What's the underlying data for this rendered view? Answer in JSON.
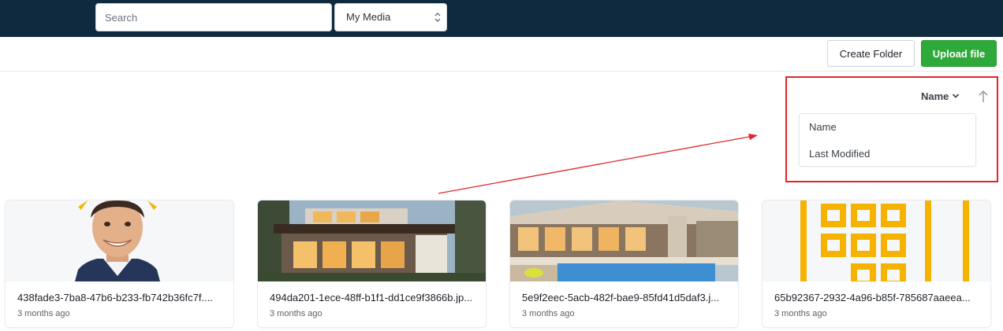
{
  "header": {
    "search": {
      "placeholder": "Search",
      "value": ""
    },
    "media_select": {
      "selected": "My Media"
    }
  },
  "toolbar": {
    "create_folder_label": "Create Folder",
    "upload_file_label": "Upload file"
  },
  "sort": {
    "current": "Name",
    "options": [
      "Name",
      "Last Modified"
    ]
  },
  "files": [
    {
      "name": "438fade3-7ba8-47b6-b233-fb742b36fc7f....",
      "modified": "3 months ago",
      "thumbnail": "portrait-worker-photo"
    },
    {
      "name": "494da201-1ece-48ff-b1f1-dd1ce9f3866b.jp...",
      "modified": "3 months ago",
      "thumbnail": "modern-house-photo"
    },
    {
      "name": "5e9f2eec-5acb-482f-bae9-85fd41d5daf3.j...",
      "modified": "3 months ago",
      "thumbnail": "house-pool-photo"
    },
    {
      "name": "65b92367-2932-4a96-b85f-785687aaeea...",
      "modified": "3 months ago",
      "thumbnail": "yellow-pattern-image"
    }
  ],
  "colors": {
    "header_bg": "#0f2a3e",
    "upload_green": "#2eaa3a",
    "annotation_red": "#e0252b"
  }
}
